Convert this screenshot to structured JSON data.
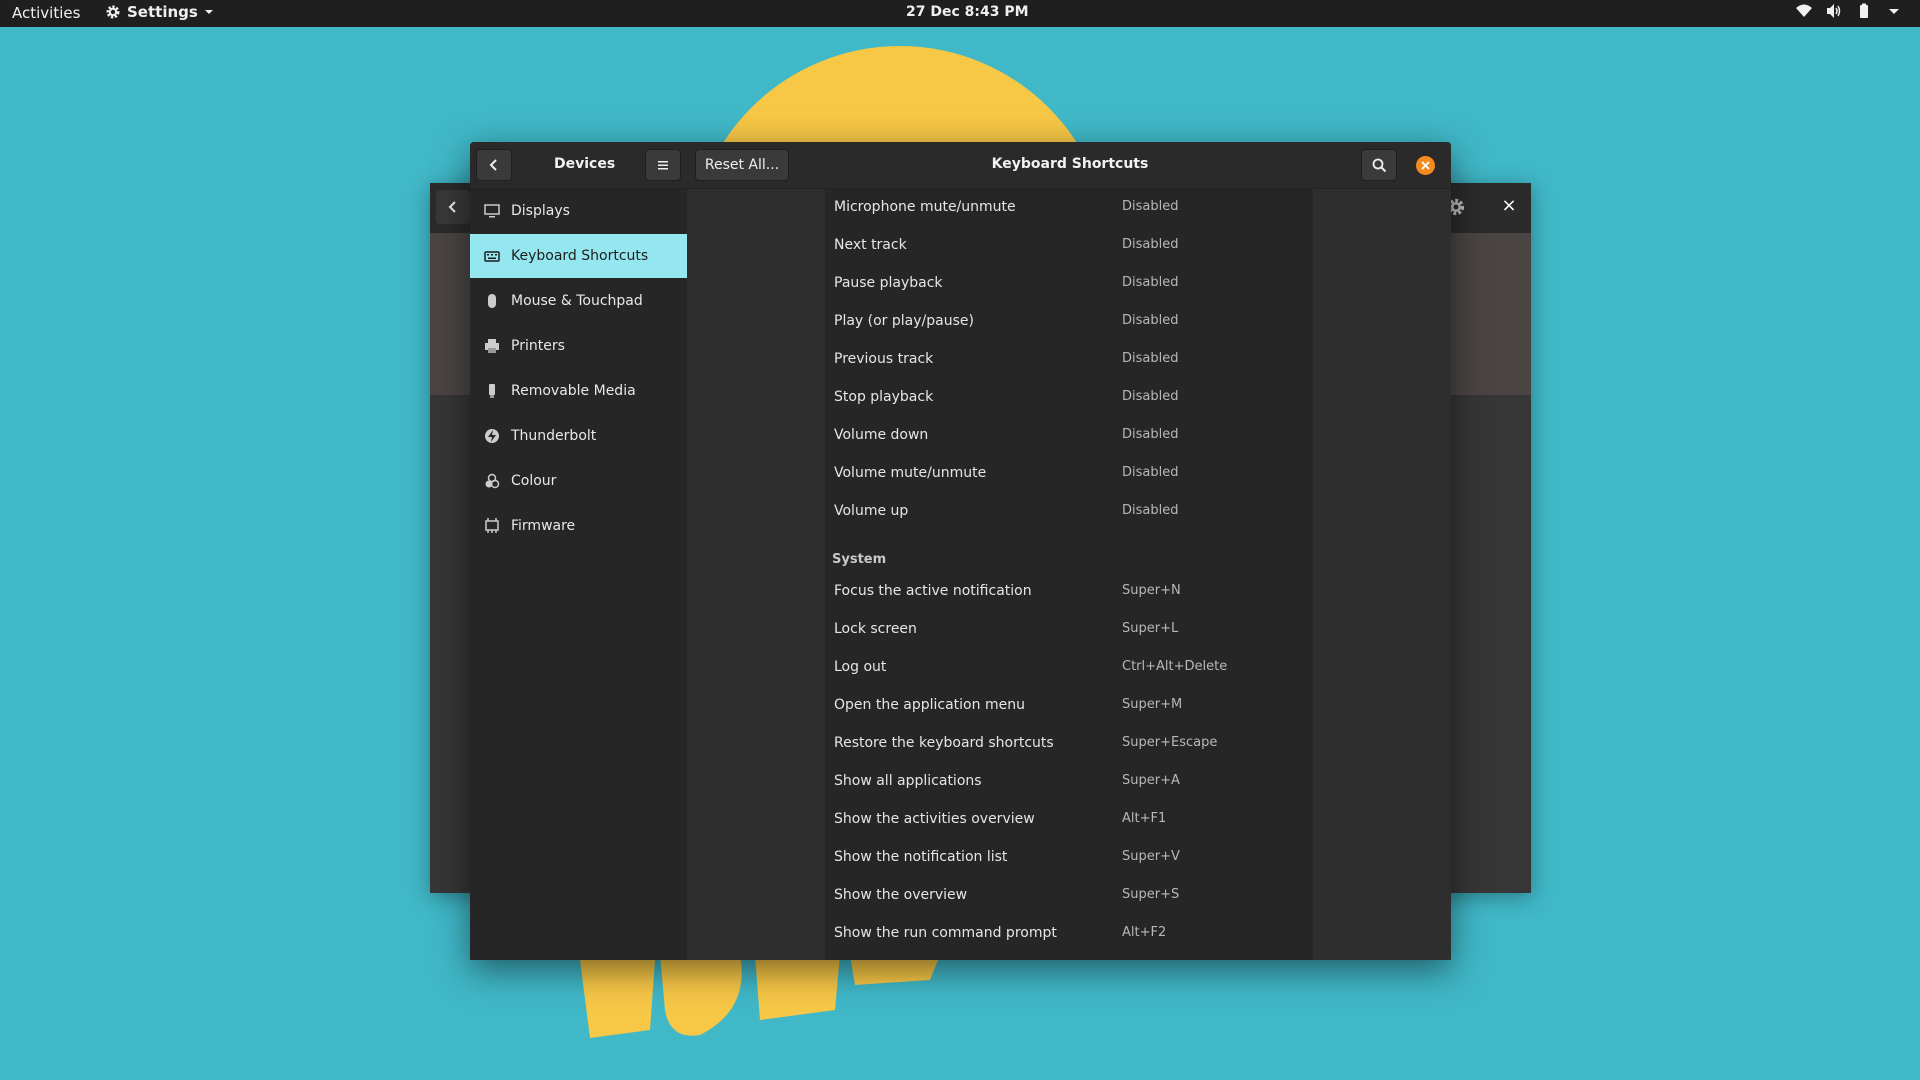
{
  "topbar": {
    "activities": "Activities",
    "app_menu": "Settings",
    "clock": "27 Dec  8:43 PM",
    "tray_icons": [
      "wifi-icon",
      "volume-icon",
      "battery-icon",
      "chevron-down-icon"
    ]
  },
  "window": {
    "sidebar_title": "Devices",
    "reset_label": "Reset All...",
    "page_title": "Keyboard Shortcuts",
    "sidebar_items": [
      {
        "label": "Displays",
        "icon": "display-icon"
      },
      {
        "label": "Keyboard Shortcuts",
        "icon": "keyboard-icon",
        "active": true
      },
      {
        "label": "Mouse & Touchpad",
        "icon": "mouse-icon"
      },
      {
        "label": "Printers",
        "icon": "printer-icon"
      },
      {
        "label": "Removable Media",
        "icon": "usb-icon"
      },
      {
        "label": "Thunderbolt",
        "icon": "thunderbolt-icon"
      },
      {
        "label": "Colour",
        "icon": "colour-icon"
      },
      {
        "label": "Firmware",
        "icon": "firmware-icon"
      }
    ],
    "sound_shortcuts": [
      {
        "name": "Microphone mute/unmute",
        "accel": "Disabled"
      },
      {
        "name": "Next track",
        "accel": "Disabled"
      },
      {
        "name": "Pause playback",
        "accel": "Disabled"
      },
      {
        "name": "Play (or play/pause)",
        "accel": "Disabled"
      },
      {
        "name": "Previous track",
        "accel": "Disabled"
      },
      {
        "name": "Stop playback",
        "accel": "Disabled"
      },
      {
        "name": "Volume down",
        "accel": "Disabled"
      },
      {
        "name": "Volume mute/unmute",
        "accel": "Disabled"
      },
      {
        "name": "Volume up",
        "accel": "Disabled"
      }
    ],
    "system_section_title": "System",
    "system_shortcuts": [
      {
        "name": "Focus the active notification",
        "accel": "Super+N"
      },
      {
        "name": "Lock screen",
        "accel": "Super+L"
      },
      {
        "name": "Log out",
        "accel": "Ctrl+Alt+Delete"
      },
      {
        "name": "Open the application menu",
        "accel": "Super+M"
      },
      {
        "name": "Restore the keyboard shortcuts",
        "accel": "Super+Escape"
      },
      {
        "name": "Show all applications",
        "accel": "Super+A"
      },
      {
        "name": "Show the activities overview",
        "accel": "Alt+F1"
      },
      {
        "name": "Show the notification list",
        "accel": "Super+V"
      },
      {
        "name": "Show the overview",
        "accel": "Super+S"
      },
      {
        "name": "Show the run command prompt",
        "accel": "Alt+F2"
      }
    ]
  },
  "colors": {
    "accent": "#94e7ef",
    "close_button": "#f58a1f",
    "wallpaper": "#40b8c8",
    "sun": "#f7c746"
  }
}
